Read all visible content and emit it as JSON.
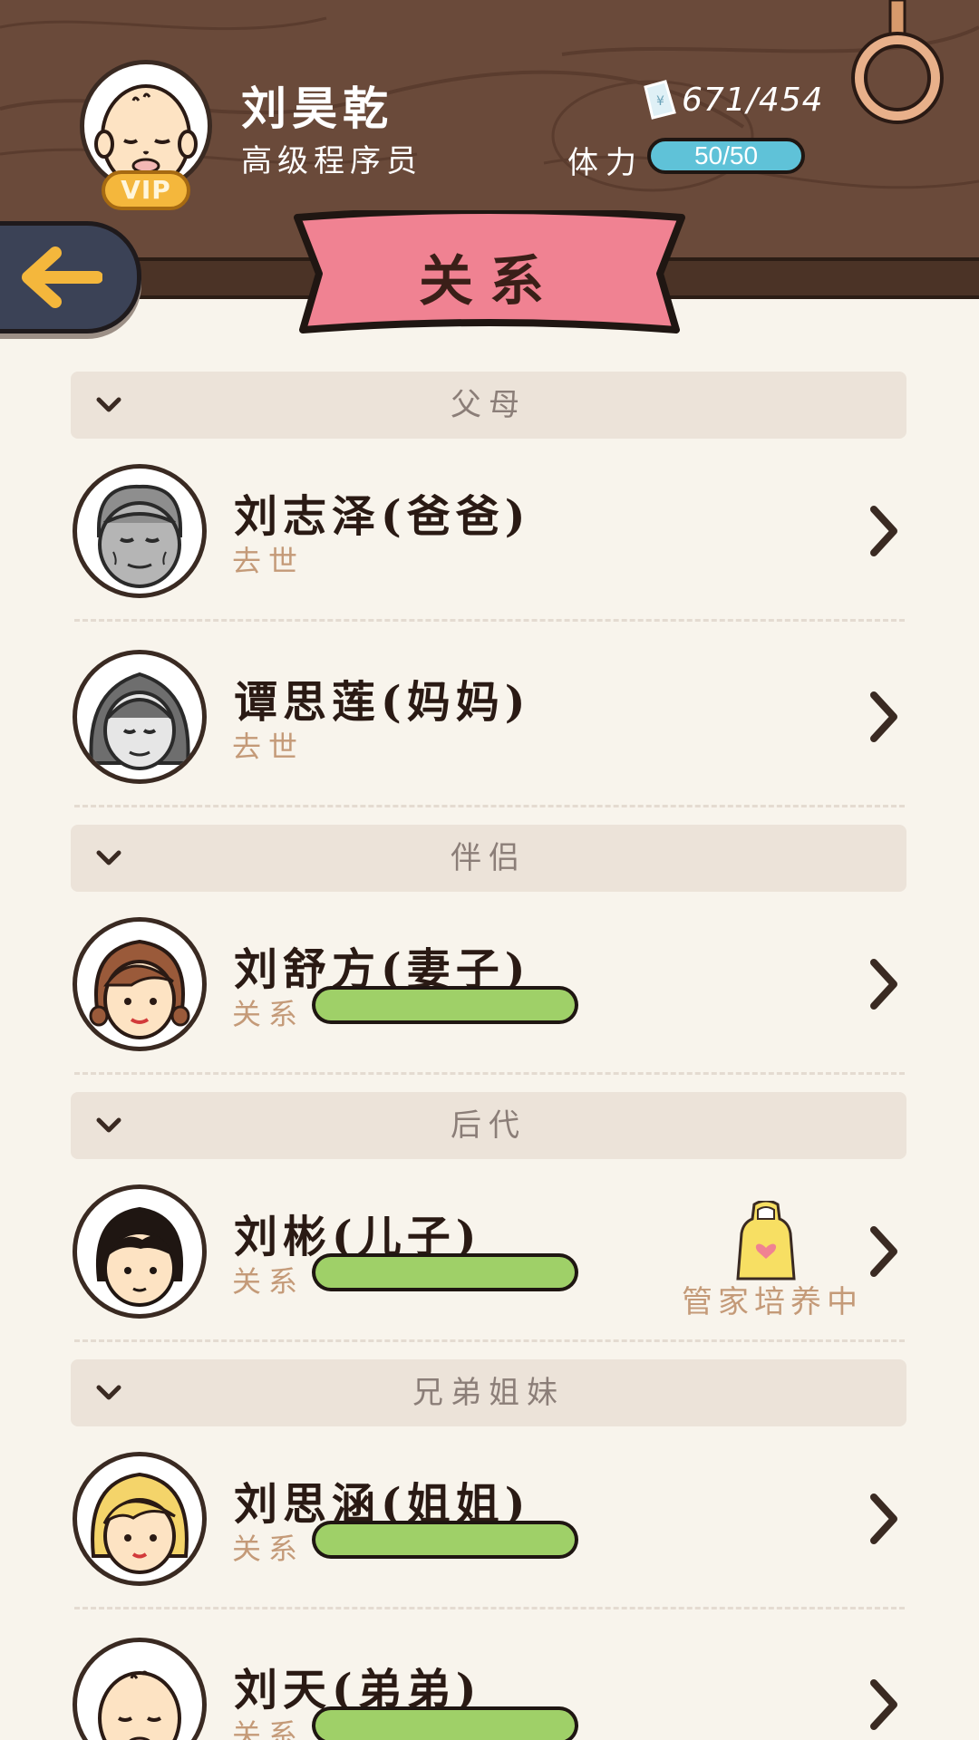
{
  "header": {
    "player_name": "刘昊乾",
    "player_title": "高级程序员",
    "vip_label": "VIP",
    "money": "671/454",
    "stamina_label": "体力",
    "stamina_value": "50/50",
    "page_title": "关系"
  },
  "sections": [
    {
      "label": "父母",
      "rows": [
        {
          "name": "刘志泽(爸爸)",
          "status": "去世",
          "portrait": "elderly-man-gray-icon"
        },
        {
          "name": "谭思莲(妈妈)",
          "status": "去世",
          "portrait": "elderly-woman-gray-icon"
        }
      ]
    },
    {
      "label": "伴侣",
      "rows": [
        {
          "name": "刘舒方(妻子)",
          "rel_label": "关系",
          "relation": 1.0,
          "portrait": "wife-portrait-icon"
        }
      ]
    },
    {
      "label": "后代",
      "rows": [
        {
          "name": "刘彬(儿子)",
          "rel_label": "关系",
          "relation": 1.0,
          "portrait": "son-portrait-icon",
          "butler": "管家培养中"
        }
      ]
    },
    {
      "label": "兄弟姐妹",
      "rows": [
        {
          "name": "刘思涵(姐姐)",
          "rel_label": "关系",
          "relation": 1.0,
          "portrait": "sister-portrait-icon"
        },
        {
          "name": "刘天(弟弟)",
          "rel_label": "关系",
          "relation": 1.0,
          "portrait": "brother-portrait-icon"
        }
      ]
    }
  ],
  "colors": {
    "wood": "#6a4a3a",
    "ribbon": "#f08292",
    "relation_bar": "#9fd068",
    "stamina_bar": "#5fc2d8",
    "status_text": "#c49a78"
  }
}
